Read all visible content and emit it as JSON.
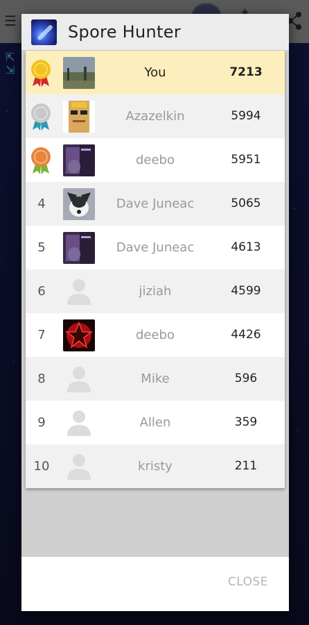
{
  "dialog": {
    "title": "Spore Hunter",
    "close_label": "CLOSE"
  },
  "background_app": {
    "menu_icon": "hamburger-menu-icon",
    "share_icon": "share-icon",
    "expand_icon": "expand-arrows-icon"
  },
  "leaderboard": [
    {
      "rank": "1",
      "medal": "gold",
      "avatar": "photo-landscape",
      "name": "You",
      "score": "7213",
      "highlight": true
    },
    {
      "rank": "2",
      "medal": "silver",
      "avatar": "photo-sunglasses",
      "name": "Azazelkin",
      "score": "5994"
    },
    {
      "rank": "3",
      "medal": "bronze",
      "avatar": "photo-guitar",
      "name": "deebo",
      "score": "5951"
    },
    {
      "rank": "4",
      "medal": "",
      "avatar": "photo-dog",
      "name": "Dave Juneac",
      "score": "5065"
    },
    {
      "rank": "5",
      "medal": "",
      "avatar": "photo-guitar",
      "name": "Dave Juneac",
      "score": "4613"
    },
    {
      "rank": "6",
      "medal": "",
      "avatar": "default-user",
      "name": "jiziah",
      "score": "4599"
    },
    {
      "rank": "7",
      "medal": "",
      "avatar": "photo-red-star",
      "name": "deebo",
      "score": "4426"
    },
    {
      "rank": "8",
      "medal": "",
      "avatar": "default-user",
      "name": "Mike",
      "score": "596"
    },
    {
      "rank": "9",
      "medal": "",
      "avatar": "default-user",
      "name": "Allen",
      "score": "359"
    },
    {
      "rank": "10",
      "medal": "",
      "avatar": "default-user",
      "name": "kristy",
      "score": "211"
    }
  ],
  "colors": {
    "highlight_row": "#fdeebd",
    "gold": "#f4c21a",
    "silver": "#c8c8c8",
    "bronze": "#e8843c",
    "ribbon_gold": "#d62a2a",
    "ribbon_silver": "#2a9ab0",
    "ribbon_bronze": "#7ab23a"
  }
}
